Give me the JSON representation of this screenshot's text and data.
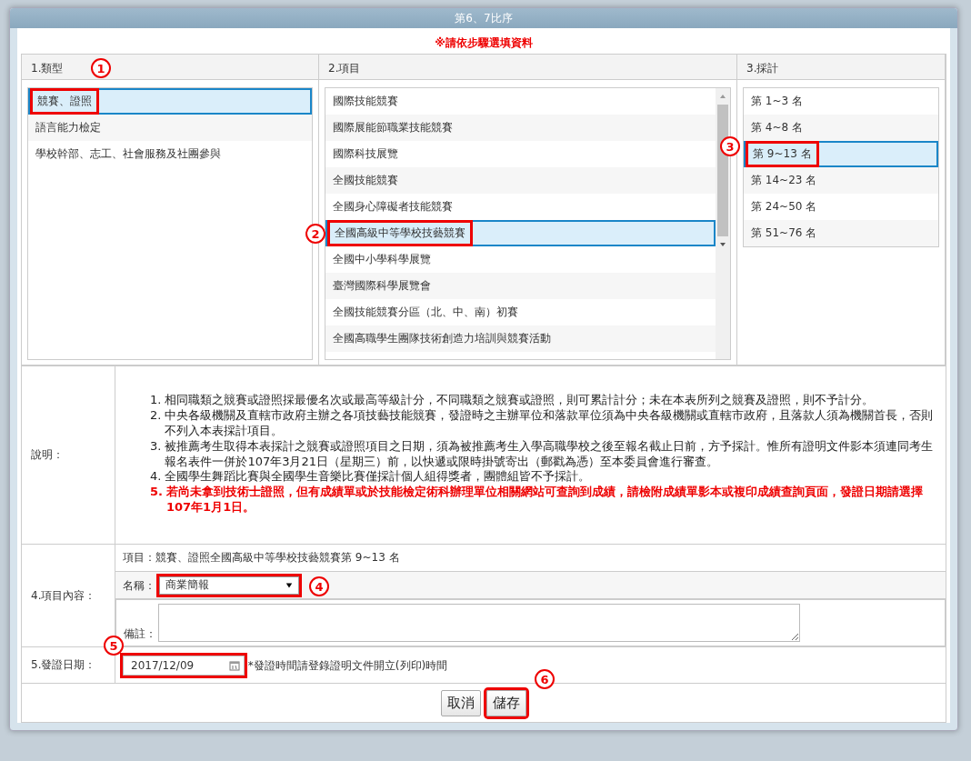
{
  "dialog": {
    "title": "第6、7比序",
    "instruction": "※請依步驟選填資料"
  },
  "columns": [
    {
      "heading": "1.類型"
    },
    {
      "heading": "2.項目"
    },
    {
      "heading": "3.採計"
    }
  ],
  "categories": [
    {
      "label": "競賽、證照",
      "selected": true,
      "highlighted": true
    },
    {
      "label": "語言能力檢定",
      "selected": false,
      "highlighted": false
    },
    {
      "label": "學校幹部、志工、社會服務及社團參與",
      "selected": false,
      "highlighted": false
    }
  ],
  "items": [
    {
      "label": "國際技能競賽",
      "selected": false,
      "highlighted": false
    },
    {
      "label": "國際展能節職業技能競賽",
      "selected": false,
      "highlighted": false
    },
    {
      "label": "國際科技展覽",
      "selected": false,
      "highlighted": false
    },
    {
      "label": "全國技能競賽",
      "selected": false,
      "highlighted": false
    },
    {
      "label": "全國身心障礙者技能競賽",
      "selected": false,
      "highlighted": false
    },
    {
      "label": "全國高級中等學校技藝競賽",
      "selected": true,
      "highlighted": true
    },
    {
      "label": "全國中小學科學展覽",
      "selected": false,
      "highlighted": false
    },
    {
      "label": "臺灣國際科學展覽會",
      "selected": false,
      "highlighted": false
    },
    {
      "label": "全國技能競賽分區（北、中、南）初賽",
      "selected": false,
      "highlighted": false
    },
    {
      "label": "全國高職學生團隊技術創造力培訓與競賽活動",
      "selected": false,
      "highlighted": false
    }
  ],
  "ranks": [
    {
      "label": "第 1~3 名",
      "selected": false,
      "highlighted": false
    },
    {
      "label": "第 4~8 名",
      "selected": false,
      "highlighted": false
    },
    {
      "label": "第 9~13 名",
      "selected": true,
      "highlighted": true
    },
    {
      "label": "第 14~23 名",
      "selected": false,
      "highlighted": false
    },
    {
      "label": "第 24~50 名",
      "selected": false,
      "highlighted": false
    },
    {
      "label": "第 51~76 名",
      "selected": false,
      "highlighted": false
    }
  ],
  "notes": {
    "label": "說明：",
    "items": [
      {
        "number": "1.",
        "text": "相同職類之競賽或證照採最優名次或最高等級計分，不同職類之競賽或證照，則可累計計分；未在本表所列之競賽及證照，則不予計分。",
        "emphasis": false
      },
      {
        "number": "2.",
        "text": "中央各級機關及直轄市政府主辦之各項技藝技能競賽，發證時之主辦單位和落款單位須為中央各級機關或直轄市政府，且落款人須為機關首長，否則不列入本表採計項目。",
        "emphasis": false
      },
      {
        "number": "3.",
        "text": "被推薦考生取得本表採計之競賽或證照項目之日期，須為被推薦考生入學高職學校之後至報名截止日前，方予採計。惟所有證明文件影本須連同考生報名表件一併於107年3月21日（星期三）前，以快遞或限時掛號寄出（郵戳為憑）至本委員會進行審查。",
        "emphasis": false
      },
      {
        "number": "4.",
        "text": "全國學生舞蹈比賽與全國學生音樂比賽僅採計個人組得獎者，團體組皆不予採計。",
        "emphasis": false
      },
      {
        "number": "5.",
        "text": "若尚未拿到技術士證照，但有成績單或於技能檢定術科辦理單位相關網站可查詢到成績，請檢附成績單影本或複印成績查詢頁面，發證日期請選擇107年1月1日。",
        "emphasis": true
      }
    ]
  },
  "content": {
    "label": "4.項目內容：",
    "summary": "項目：競賽、證照全國高級中等學校技藝競賽第 9~13 名",
    "name_label": "名稱：",
    "name_value": "商業簡報",
    "name_highlighted": true,
    "remark_label": "備註："
  },
  "issue_date": {
    "label": "5.發證日期：",
    "value": "2017/12/09",
    "highlighted": true,
    "hint": "*發證時間請登錄證明文件開立(列印)時間"
  },
  "buttons": [
    {
      "label": "取消",
      "highlighted": false
    },
    {
      "label": "儲存",
      "highlighted": true
    }
  ],
  "annotations": [
    {
      "label": "1"
    },
    {
      "label": "2"
    },
    {
      "label": "3"
    },
    {
      "label": "4"
    },
    {
      "label": "5"
    },
    {
      "label": "6"
    }
  ]
}
